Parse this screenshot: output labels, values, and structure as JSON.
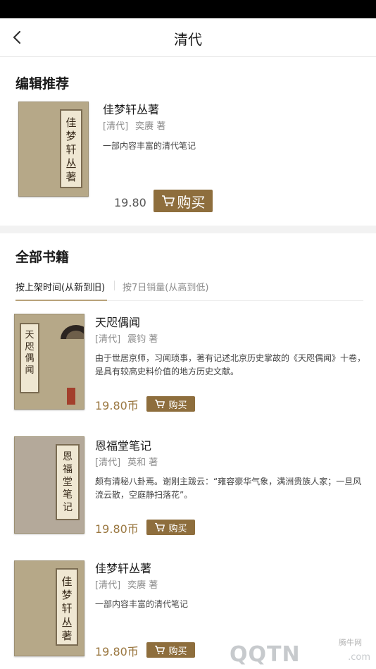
{
  "nav": {
    "title": "清代"
  },
  "recommend": {
    "section_title": "编辑推荐",
    "book": {
      "title": "佳梦轩丛著",
      "dynasty": "[清代]",
      "author": "奕赓 著",
      "desc": "一部内容丰富的清代笔记",
      "price": "19.80",
      "buy_label": "购买",
      "cover_text": "佳梦轩丛著"
    }
  },
  "all_books": {
    "section_title": "全部书籍",
    "tabs": [
      {
        "label": "按上架时间(从新到旧)",
        "active": true
      },
      {
        "label": "按7日销量(从高到低)",
        "active": false
      }
    ],
    "items": [
      {
        "title": "天咫偶闻",
        "dynasty": "[清代]",
        "author": "震钧 著",
        "desc": "由于世居京师，习闻琐事，著有记述北京历史掌故的《天咫偶闻》十卷，是具有较高史料价值的地方历史文献。",
        "price": "19.80币",
        "buy_label": "购买",
        "cover_text": "天咫偶闻"
      },
      {
        "title": "恩福堂笔记",
        "dynasty": "[清代]",
        "author": "英和 著",
        "desc": "颇有清秘八卦焉。谢刚主跋云：“雍容豪华气象，满洲贵族人家；一旦风流云散，空庭静扫落花”。",
        "price": "19.80币",
        "buy_label": "购买",
        "cover_text": "恩福堂笔记"
      },
      {
        "title": "佳梦轩丛著",
        "dynasty": "[清代]",
        "author": "奕赓 著",
        "desc": "一部内容丰富的清代笔记",
        "price": "19.80币",
        "buy_label": "购买",
        "cover_text": "佳梦轩丛著"
      }
    ]
  },
  "watermark": {
    "small": "腾牛网",
    "logo": "QQTN",
    "domain": ".com"
  },
  "colors": {
    "accent": "#8e6e3d",
    "price": "#9a7740",
    "tab_underline": "#b8a27a"
  }
}
